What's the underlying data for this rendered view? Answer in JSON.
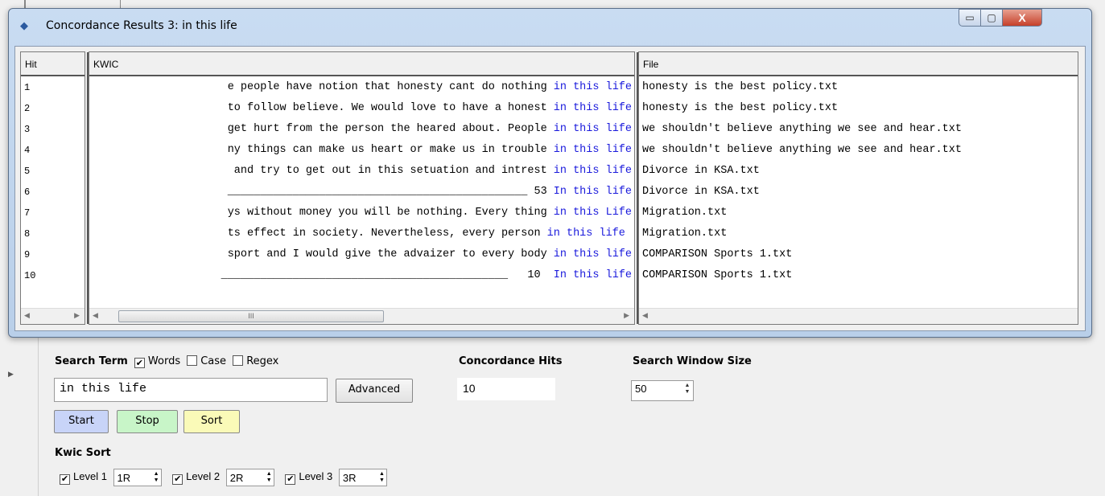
{
  "window": {
    "title": "Concordance Results 3: in this life",
    "controls": {
      "minimize": "▭",
      "maximize": "▢",
      "close": "X"
    }
  },
  "columns": {
    "hit": "Hit",
    "kwic": "KWIC",
    "file": "File"
  },
  "results": [
    {
      "hit": "1",
      "left": "e people have notion that honesty cant do nothing ",
      "kw": "in this life",
      "file": "honesty is the best policy.txt"
    },
    {
      "hit": "2",
      "left": "to follow believe. We would love to have a honest ",
      "kw": "in this life",
      "file": "honesty is the best policy.txt"
    },
    {
      "hit": "3",
      "left": "get hurt from the person the heared about. People ",
      "kw": "in this life",
      "file": "we shouldn't believe anything we see and hear.txt"
    },
    {
      "hit": "4",
      "left": "ny things can make us heart or make us in trouble ",
      "kw": "in this life",
      "file": "we shouldn't believe anything we see and hear.txt"
    },
    {
      "hit": "5",
      "left": " and try to get out in this setuation and intrest ",
      "kw": "in this life",
      "file": "Divorce in KSA.txt"
    },
    {
      "hit": "6",
      "left": "______________________________________________ 53 ",
      "kw": "In this life",
      "file": "Divorce in KSA.txt"
    },
    {
      "hit": "7",
      "left": "ys without money you will be nothing. Every thing ",
      "kw": "in this Life",
      "file": "Migration.txt"
    },
    {
      "hit": "8",
      "left": "ts effect in society. Nevertheless, every person ",
      "kw": "in this life ",
      "file": "Migration.txt"
    },
    {
      "hit": "9",
      "left": "sport and I would give the advaizer to every body ",
      "kw": "in this life",
      "file": "COMPARISON Sports 1.txt"
    },
    {
      "hit": "10",
      "left": "____________________________________________   10  ",
      "kw": "In this life",
      "file": "COMPARISON Sports 1.txt"
    }
  ],
  "scroll": {
    "thumb_grip": "III",
    "left_arrow": "◀",
    "right_arrow": "▶"
  },
  "search": {
    "label": "Search Term",
    "words_label": "Words",
    "case_label": "Case",
    "regex_label": "Regex",
    "check": "✔",
    "value": "in this life",
    "advanced": "Advanced"
  },
  "hits": {
    "label": "Concordance Hits",
    "value": "10"
  },
  "window_size": {
    "label": "Search Window Size",
    "value": "50"
  },
  "buttons": {
    "start": "Start",
    "stop": "Stop",
    "sort": "Sort"
  },
  "kwic_sort": {
    "label": "Kwic Sort",
    "levels": [
      {
        "label": "Level 1",
        "value": "1R"
      },
      {
        "label": "Level 2",
        "value": "2R"
      },
      {
        "label": "Level 3",
        "value": "3R"
      }
    ]
  },
  "colors": {
    "keyword": "#1a1adc",
    "start_btn": "#c8d4f8",
    "stop_btn": "#c8f5c8",
    "sort_btn": "#fafab8"
  }
}
